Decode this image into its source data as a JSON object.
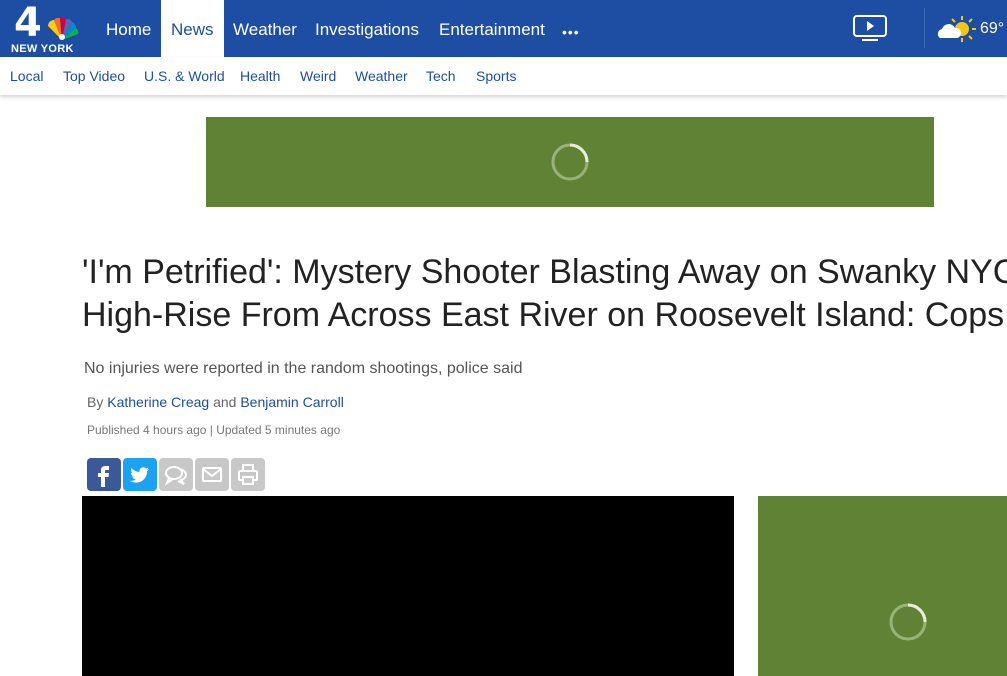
{
  "brand": {
    "logo_number": "4",
    "logo_location": "NEW YORK"
  },
  "top_nav": {
    "items": [
      "Home",
      "News",
      "Weather",
      "Investigations",
      "Entertainment"
    ],
    "active": "News",
    "more": "•••",
    "temperature": "69°"
  },
  "sub_nav": {
    "items": [
      "Local",
      "Top Video",
      "U.S. & World",
      "Health",
      "Weird",
      "Weather",
      "Tech",
      "Sports"
    ]
  },
  "article": {
    "headline_line1": "'I'm Petrified': Mystery Shooter Blasting Away on Swanky NYC",
    "headline_line2": "High-Rise From Across East River on Roosevelt Island: Cops",
    "dek": "No injuries were reported in the random shootings, police said",
    "byline_prefix": "By",
    "author1": "Katherine Creag",
    "byline_and": "and",
    "author2": "Benjamin Carroll",
    "dates": "Published 4 hours ago | Updated 5 minutes ago"
  },
  "share_buttons": [
    "facebook",
    "twitter",
    "comments",
    "email",
    "print"
  ],
  "colors": {
    "nav_blue": "#1d4ea3",
    "ad_green": "#5f8234",
    "facebook": "#3b5998",
    "twitter": "#1da1f2",
    "disabled_gray": "#c8c8c8"
  }
}
